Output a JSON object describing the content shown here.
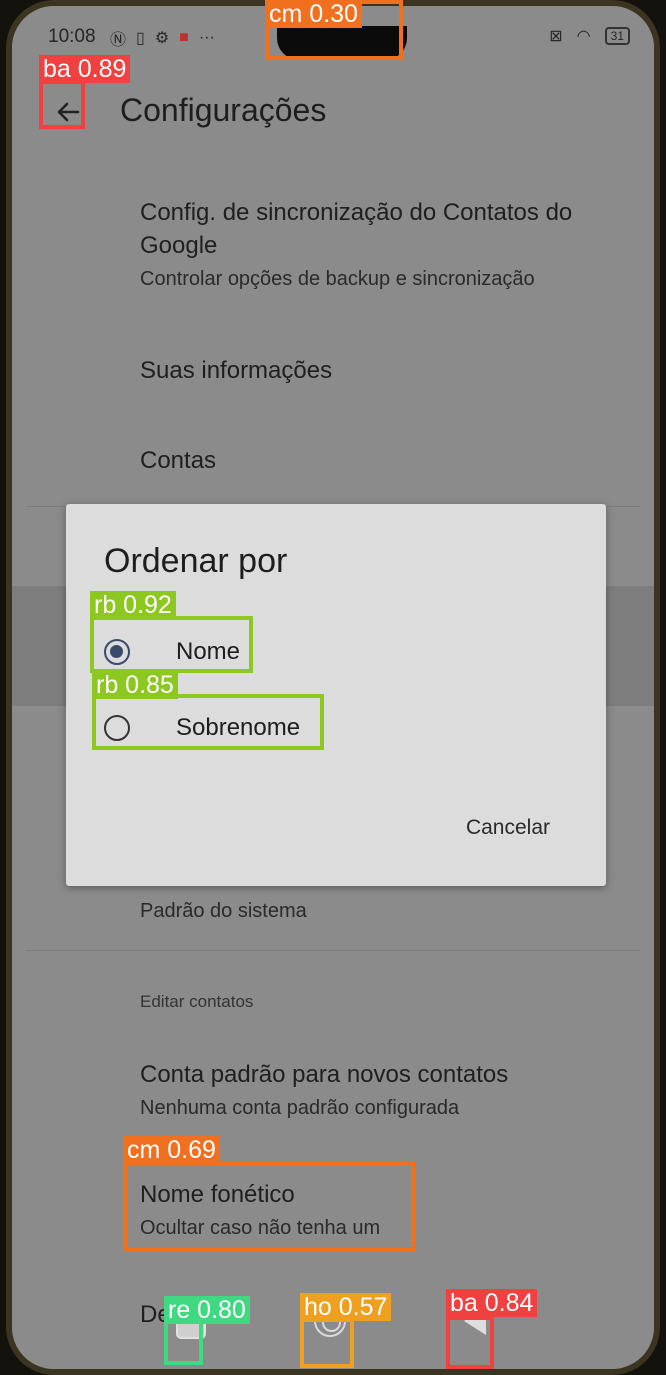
{
  "status_bar": {
    "time": "10:08",
    "icons_left": [
      "nfc-icon",
      "sim-icon",
      "gear-icon",
      "mail-icon",
      "more-icon"
    ],
    "icons_right": [
      "mute-icon",
      "wifi-icon",
      "battery-icon"
    ],
    "battery_level": "31"
  },
  "header": {
    "title": "Configurações"
  },
  "settings": {
    "sync": {
      "title": "Config. de sincronização do Contatos do Google",
      "subtitle": "Controlar opções de backup e sincronização"
    },
    "your_info": {
      "title": "Suas informações"
    },
    "accounts": {
      "title": "Contas"
    },
    "system_default": {
      "title": "Padrão do sistema"
    },
    "edit_contacts_section": "Editar contatos",
    "default_account": {
      "title": "Conta padrão para novos contatos",
      "subtitle": "Nenhuma conta padrão configurada"
    },
    "phonetic_name": {
      "title": "Nome fonético",
      "subtitle": "Ocultar caso não tenha um"
    },
    "partial_item": "Des"
  },
  "dialog": {
    "title": "Ordenar por",
    "options": [
      {
        "label": "Nome",
        "selected": true
      },
      {
        "label": "Sobrenome",
        "selected": false
      }
    ],
    "cancel_label": "Cancelar"
  },
  "detections": [
    {
      "label": "cm 0.30",
      "color": "#f07020"
    },
    {
      "label": "ba 0.89",
      "color": "#f04040"
    },
    {
      "label": "rb 0.92",
      "color": "#8cc820"
    },
    {
      "label": "rb 0.85",
      "color": "#8cc820"
    },
    {
      "label": "cm 0.69",
      "color": "#f07020"
    },
    {
      "label": "re 0.80",
      "color": "#40d880"
    },
    {
      "label": "ho 0.57",
      "color": "#f0a020"
    },
    {
      "label": "ba 0.84",
      "color": "#f04040"
    }
  ]
}
